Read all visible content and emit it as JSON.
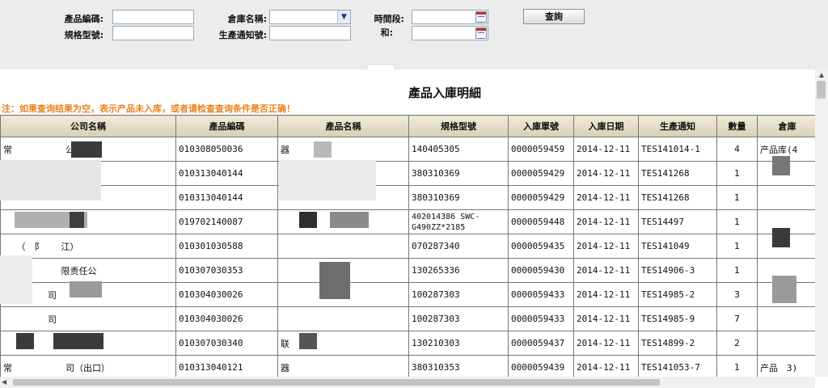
{
  "filters": {
    "product_code_label": "產品編碼:",
    "spec_model_label": "規格型號:",
    "warehouse_label": "倉庫名稱:",
    "production_notice_label": "生產通知號:",
    "period_label": "時間段:",
    "and_label": "和:",
    "product_code_value": "",
    "spec_model_value": "",
    "warehouse_value": "",
    "production_notice_value": "",
    "date_from_value": "",
    "date_to_value": "",
    "query_button": "查詢"
  },
  "report": {
    "title": "產品入庫明細",
    "notice": "注：如果查询结果为空，表示产品未入库，或者请检查查询条件是否正确！",
    "columns": [
      "公司名稱",
      "產品編碼",
      "產品名稱",
      "規格型號",
      "入庫單號",
      "入庫日期",
      "生產通知",
      "數量",
      "倉庫"
    ],
    "rows": [
      {
        "company": "常　　　　　　公司",
        "product_code": "010308050036",
        "product_name": "器",
        "spec": "140405305",
        "receipt_no": "0000059459",
        "date": "2014-12-11",
        "notice": "TES141014-1",
        "qty": "4",
        "warehouse": "产品库(4"
      },
      {
        "company": "",
        "product_code": "010313040144",
        "product_name": "",
        "spec": "380310369",
        "receipt_no": "0000059429",
        "date": "2014-12-11",
        "notice": "TES141268",
        "qty": "1",
        "warehouse": ""
      },
      {
        "company": "",
        "product_code": "010313040144",
        "product_name": "",
        "spec": "380310369",
        "receipt_no": "0000059429",
        "date": "2014-12-11",
        "notice": "TES141268",
        "qty": "1",
        "warehouse": ""
      },
      {
        "company": "　　　　责　司",
        "product_code": "019702140087",
        "product_name": "",
        "spec": "402014386 SWC-G490ZZ*2185",
        "receipt_no": "0000059448",
        "date": "2014-12-11",
        "notice": "TES14497",
        "qty": "1",
        "warehouse": ""
      },
      {
        "company": "　　（　阝　　江）",
        "product_code": "010301030588",
        "product_name": "",
        "spec": "070287340",
        "receipt_no": "0000059435",
        "date": "2014-12-11",
        "notice": "TES141049",
        "qty": "1",
        "warehouse": ""
      },
      {
        "company": "　　（　　　　限责任公",
        "product_code": "010307030353",
        "product_name": "",
        "spec": "130265336",
        "receipt_no": "0000059430",
        "date": "2014-12-11",
        "notice": "TES14906-3",
        "qty": "1",
        "warehouse": ""
      },
      {
        "company": "　　　　　司",
        "product_code": "010304030026",
        "product_name": "",
        "spec": "100287303",
        "receipt_no": "0000059433",
        "date": "2014-12-11",
        "notice": "TES14985-2",
        "qty": "3",
        "warehouse": ""
      },
      {
        "company": "　　　　　司",
        "product_code": "010304030026",
        "product_name": "",
        "spec": "100287303",
        "receipt_no": "0000059433",
        "date": "2014-12-11",
        "notice": "TES14985-9",
        "qty": "7",
        "warehouse": ""
      },
      {
        "company": "",
        "product_code": "010307030340",
        "product_name": "联",
        "spec": "130210303",
        "receipt_no": "0000059437",
        "date": "2014-12-11",
        "notice": "TES14899-2",
        "qty": "2",
        "warehouse": ""
      },
      {
        "company": "常　　　　　　司（出口）",
        "product_code": "010313040121",
        "product_name": "器",
        "spec": "380310353",
        "receipt_no": "0000059439",
        "date": "2014-12-11",
        "notice": "TES141053-7",
        "qty": "1",
        "warehouse": "产品　3)"
      }
    ]
  },
  "colors": {
    "notice": "#e8821e",
    "header_bg": "#e4ddcc",
    "filter_bg": "#ececec"
  }
}
